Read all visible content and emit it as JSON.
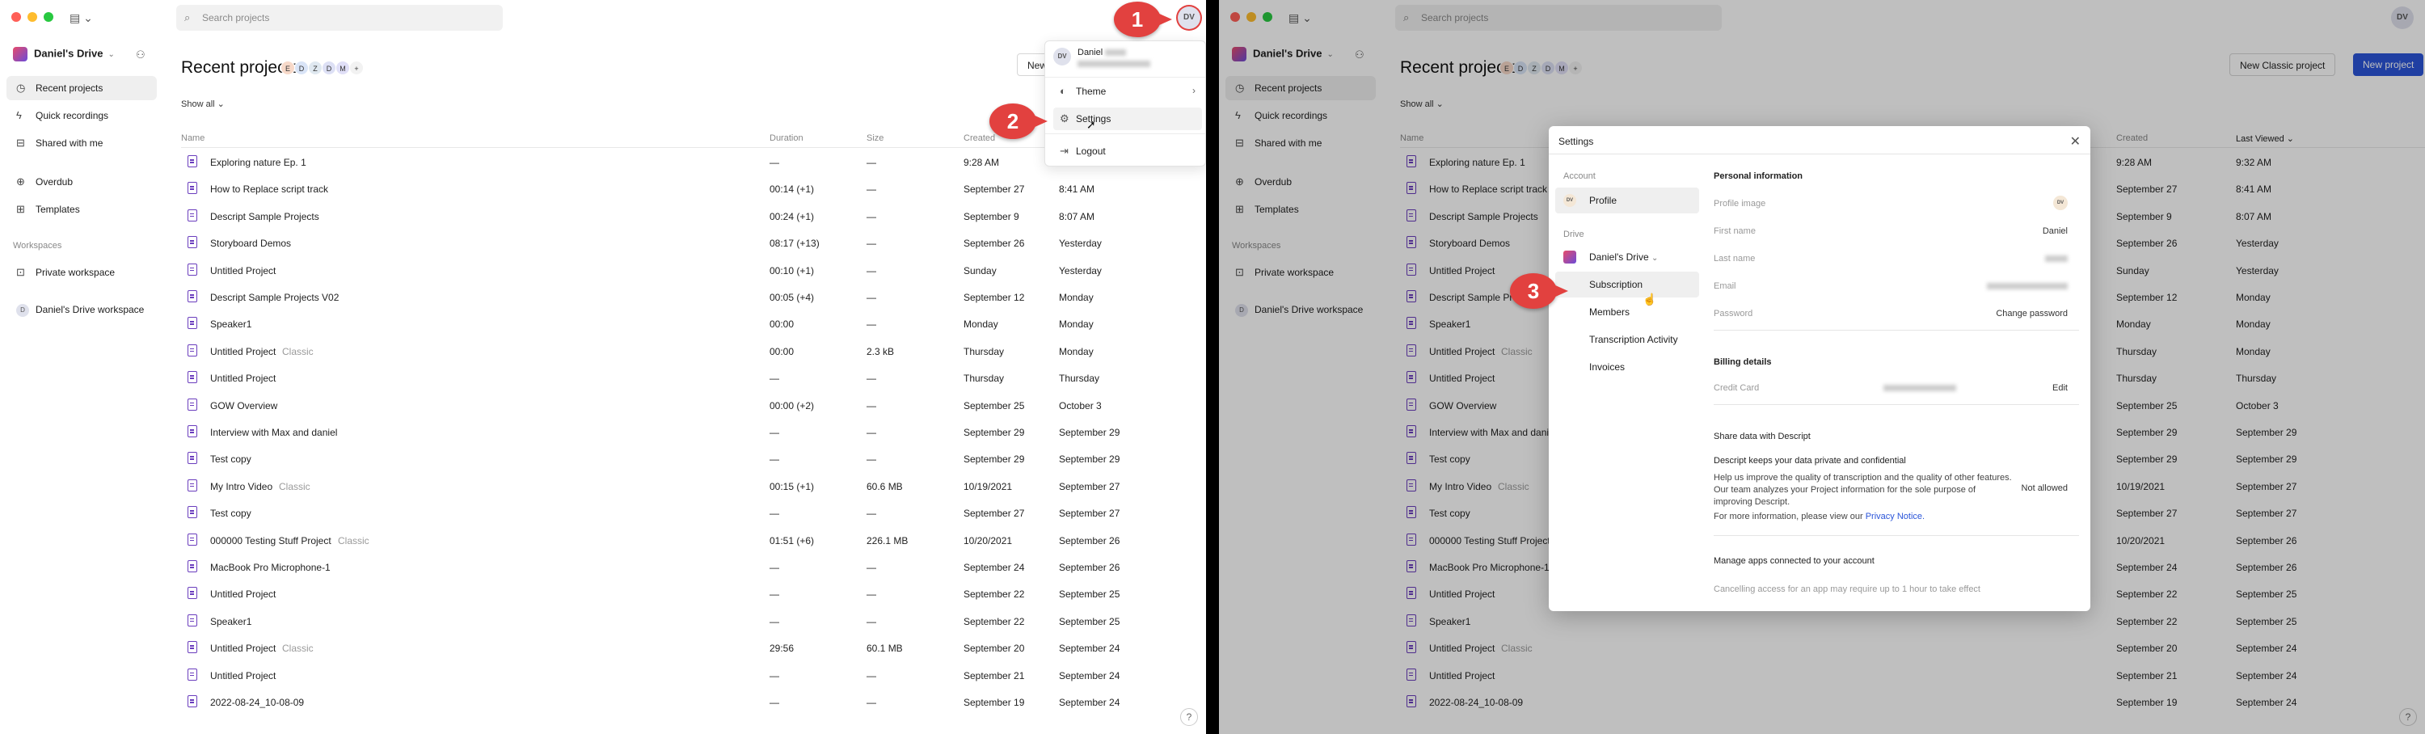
{
  "search": {
    "placeholder": "Search projects"
  },
  "avatar_initials": "DV",
  "sidebar": {
    "drive": "Daniel's Drive",
    "items": [
      {
        "label": "Recent projects",
        "icon": "clock-icon"
      },
      {
        "label": "Quick recordings",
        "icon": "bolt-icon"
      },
      {
        "label": "Shared with me",
        "icon": "inbox-icon"
      },
      {
        "label": "Overdub",
        "icon": "overdub-icon"
      },
      {
        "label": "Templates",
        "icon": "grid-icon"
      }
    ],
    "workspaces_label": "Workspaces",
    "workspaces": [
      {
        "label": "Private workspace",
        "icon": "lock-icon"
      },
      {
        "label": "Daniel's Drive workspace",
        "avatar": "D"
      }
    ]
  },
  "main": {
    "title": "Recent projects",
    "members": [
      "E",
      "D",
      "Z",
      "D",
      "M",
      "+"
    ],
    "show_all": "Show all",
    "new_classic": "New Classic project",
    "new_project": "New project",
    "new_truncated": "New",
    "columns": {
      "name": "Name",
      "duration": "Duration",
      "size": "Size",
      "created": "Created",
      "last_viewed": "Last Viewed"
    }
  },
  "projects": [
    {
      "name": "Exploring nature Ep. 1",
      "tag": "",
      "duration": "—",
      "size": "—",
      "created": "9:28 AM",
      "viewed": "9:32 AM"
    },
    {
      "name": "How to Replace script track",
      "tag": "",
      "duration": "00:14 (+1)",
      "size": "—",
      "created": "September 27",
      "viewed": "8:41 AM"
    },
    {
      "name": "Descript Sample Projects",
      "tag": "",
      "duration": "00:24 (+1)",
      "size": "—",
      "created": "September 9",
      "viewed": "8:07 AM"
    },
    {
      "name": "Storyboard Demos",
      "tag": "",
      "duration": "08:17 (+13)",
      "size": "—",
      "created": "September 26",
      "viewed": "Yesterday"
    },
    {
      "name": "Untitled Project",
      "tag": "",
      "duration": "00:10 (+1)",
      "size": "—",
      "created": "Sunday",
      "viewed": "Yesterday"
    },
    {
      "name": "Descript Sample Projects V02",
      "tag": "",
      "duration": "00:05 (+4)",
      "size": "—",
      "created": "September 12",
      "viewed": "Monday"
    },
    {
      "name": "Speaker1",
      "tag": "",
      "duration": "00:00",
      "size": "—",
      "created": "Monday",
      "viewed": "Monday"
    },
    {
      "name": "Untitled Project",
      "tag": "Classic",
      "duration": "00:00",
      "size": "2.3 kB",
      "created": "Thursday",
      "viewed": "Monday"
    },
    {
      "name": "Untitled Project",
      "tag": "",
      "duration": "—",
      "size": "—",
      "created": "Thursday",
      "viewed": "Thursday"
    },
    {
      "name": "GOW Overview",
      "tag": "",
      "duration": "00:00 (+2)",
      "size": "—",
      "created": "September 25",
      "viewed": "October 3"
    },
    {
      "name": "Interview with Max and daniel",
      "tag": "",
      "duration": "—",
      "size": "—",
      "created": "September 29",
      "viewed": "September 29"
    },
    {
      "name": "Test copy",
      "tag": "",
      "duration": "—",
      "size": "—",
      "created": "September 29",
      "viewed": "September 29"
    },
    {
      "name": "My Intro Video",
      "tag": "Classic",
      "duration": "00:15 (+1)",
      "size": "60.6 MB",
      "created": "10/19/2021",
      "viewed": "September 27"
    },
    {
      "name": "Test copy",
      "tag": "",
      "duration": "—",
      "size": "—",
      "created": "September 27",
      "viewed": "September 27"
    },
    {
      "name": "000000 Testing Stuff Project",
      "tag": "Classic",
      "duration": "01:51 (+6)",
      "size": "226.1 MB",
      "created": "10/20/2021",
      "viewed": "September 26"
    },
    {
      "name": "MacBook Pro Microphone-1",
      "tag": "",
      "duration": "—",
      "size": "—",
      "created": "September 24",
      "viewed": "September 26"
    },
    {
      "name": "Untitled Project",
      "tag": "",
      "duration": "—",
      "size": "—",
      "created": "September 22",
      "viewed": "September 25"
    },
    {
      "name": "Speaker1",
      "tag": "",
      "duration": "—",
      "size": "—",
      "created": "September 22",
      "viewed": "September 25"
    },
    {
      "name": "Untitled Project",
      "tag": "Classic",
      "duration": "29:56",
      "size": "60.1 MB",
      "created": "September 20",
      "viewed": "September 24"
    },
    {
      "name": "Untitled Project",
      "tag": "",
      "duration": "—",
      "size": "—",
      "created": "September 21",
      "viewed": "September 24"
    },
    {
      "name": "2022-08-24_10-08-09",
      "tag": "",
      "duration": "—",
      "size": "—",
      "created": "September 19",
      "viewed": "September 24"
    }
  ],
  "account_menu": {
    "name": "Daniel",
    "items": [
      {
        "label": "Theme",
        "icon": "theme-icon"
      },
      {
        "label": "Settings",
        "icon": "gear-icon"
      },
      {
        "label": "Logout",
        "icon": "logout-icon"
      }
    ]
  },
  "callouts": [
    "1",
    "2",
    "3"
  ],
  "settings": {
    "title": "Settings",
    "account_label": "Account",
    "profile": "Profile",
    "drive_label": "Drive",
    "drive_name": "Daniel's Drive",
    "nav": [
      "Subscription",
      "Members",
      "Transcription Activity",
      "Invoices"
    ],
    "personal_info": "Personal information",
    "fields": [
      {
        "label": "Profile image",
        "value": ""
      },
      {
        "label": "First name",
        "value": "Daniel"
      },
      {
        "label": "Last name",
        "value": ""
      },
      {
        "label": "Email",
        "value": ""
      },
      {
        "label": "Password",
        "value": "Change password"
      }
    ],
    "billing": "Billing details",
    "credit_card_label": "Credit Card",
    "edit": "Edit",
    "share_heading": "Share data with Descript",
    "share_sub": "Descript keeps your data private and confidential",
    "share_text": "Help us improve the quality of transcription and the quality of other features. Our team analyzes your Project information for the sole purpose of improving Descript.",
    "share_more": "For more information, please view our",
    "privacy": "Privacy Notice.",
    "not_allowed": "Not allowed",
    "apps_heading": "Manage apps connected to your account",
    "apps_text": "Cancelling access for an app may require up to 1 hour to take effect"
  },
  "colors": {
    "brand_blue": "#2b55d9",
    "callout": "#e2413f",
    "file_icon": "#6a3dbd"
  }
}
